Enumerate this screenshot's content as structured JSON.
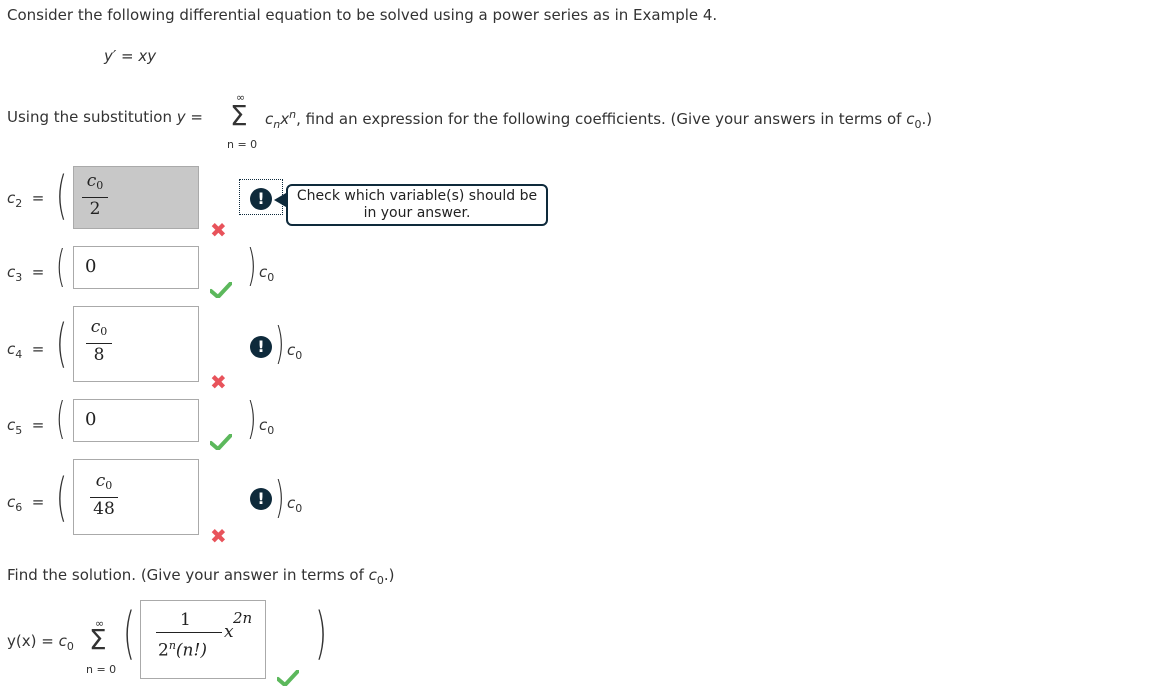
{
  "intro": "Consider the following differential equation to be solved using a power series as in Example 4.",
  "equation": "y′ = xy",
  "substitution": {
    "before": "Using the substitution ",
    "y_var": "y",
    "eq": " = ",
    "sum_top": "∞",
    "sum_bottom": "n = 0",
    "term_c": "c",
    "term_n": "n",
    "term_x": "x",
    "term_exp": "n",
    "after": ", find an expression for the following coefficients. (Give your answers in terms of ",
    "c0_c": "c",
    "c0_sub": "0",
    "close": ".)"
  },
  "coefficients": [
    {
      "label_c": "c",
      "label_sub": "2",
      "eq": "=",
      "num_c": "c",
      "num_sub": "0",
      "den": "2",
      "answer": "",
      "status": "wrong",
      "tail": ""
    },
    {
      "label_c": "c",
      "label_sub": "3",
      "eq": "=",
      "answer": "0",
      "status": "correct",
      "tail_c": "c",
      "tail_sub": "0"
    },
    {
      "label_c": "c",
      "label_sub": "4",
      "eq": "=",
      "num_c": "c",
      "num_sub": "0",
      "den": "8",
      "status": "wrong",
      "tail_c": "c",
      "tail_sub": "0"
    },
    {
      "label_c": "c",
      "label_sub": "5",
      "eq": "=",
      "answer": "0",
      "status": "correct",
      "tail_c": "c",
      "tail_sub": "0"
    },
    {
      "label_c": "c",
      "label_sub": "6",
      "eq": "=",
      "num_c": "c",
      "num_sub": "0",
      "den": "48",
      "status": "wrong",
      "tail_c": "c",
      "tail_sub": "0"
    }
  ],
  "tooltip": "Check which variable(s) should be in your answer.",
  "find_solution": {
    "text": "Find the solution. (Give your answer in terms of ",
    "c0_c": "c",
    "c0_sub": "0",
    "close": ".)"
  },
  "solution": {
    "lhs": "y(x) = ",
    "c0_c": "c",
    "c0_sub": "0",
    "sum_top": "∞",
    "sum_bottom": "n = 0",
    "num": "1",
    "den_base": "2",
    "den_exp": "n",
    "den_rest": "(n!)",
    "x": "x",
    "x_exp": "2n",
    "status": "correct"
  },
  "colors": {
    "wrong": "#e8535b",
    "correct": "#5cb85c",
    "alert": "#0e2a3b"
  },
  "icons": {
    "wrong": "x-mark-icon",
    "correct": "check-mark-icon",
    "alert": "exclamation-icon"
  }
}
